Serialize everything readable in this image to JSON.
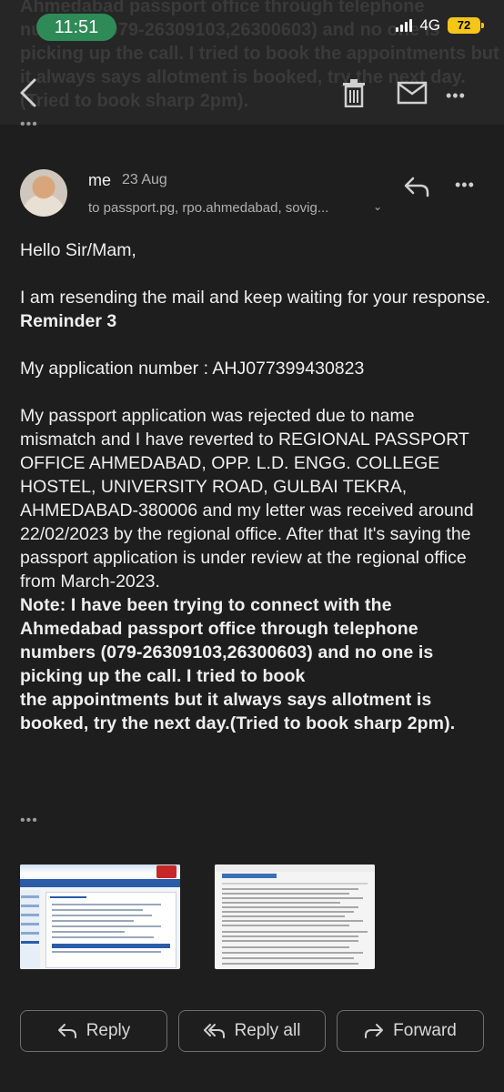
{
  "status_bar": {
    "time": "11:51",
    "network": "4G",
    "battery": "72"
  },
  "background_preview_text": "Ahmedabad passport office through telephone numbers (079-26309103,26300603) and no one is picking up the call. I tried to book the appointments but it always says allotment is booked, try the next day.(Tried to book sharp 2pm).",
  "toolbar": {
    "back_icon": "back-arrow-icon",
    "delete_icon": "trash-icon",
    "mark_unread_icon": "envelope-icon",
    "more_icon": "more-vertical-icon"
  },
  "message": {
    "sender": "me",
    "date": "23 Aug",
    "recipients": "to passport.pg, rpo.ahmedabad, sovig...",
    "body": {
      "greeting": "Hello Sir/Mam,",
      "para1_plain": "I am resending the mail and keep waiting for your response. ",
      "para1_bold": "Reminder 3",
      "application_line": "My application number : AHJ077399430823",
      "para3": "My passport application was rejected due to name mismatch and I have reverted to REGIONAL PASSPORT OFFICE AHMEDABAD, OPP. L.D. ENGG. COLLEGE HOSTEL, UNIVERSITY ROAD, GULBAI TEKRA, AHMEDABAD-380006 and my letter was received around 22/02/2023 by the regional office. After that It's saying the passport application is under review at the regional office from March-2023.",
      "note_line1": "Note: I have been trying to connect with the Ahmedabad passport office through telephone numbers (079-26309103,26300603) and no one is picking up the call. I tried to book",
      "note_line2": "the appointments but it always says allotment is booked, try the next day.(Tried to book sharp 2pm)."
    }
  },
  "actions": {
    "reply": "Reply",
    "reply_all": "Reply all",
    "forward": "Forward"
  },
  "colors": {
    "background": "#1e1e1e",
    "toolbar": "#262626",
    "time_pill": "#2e8b57",
    "battery": "#f5c518"
  }
}
